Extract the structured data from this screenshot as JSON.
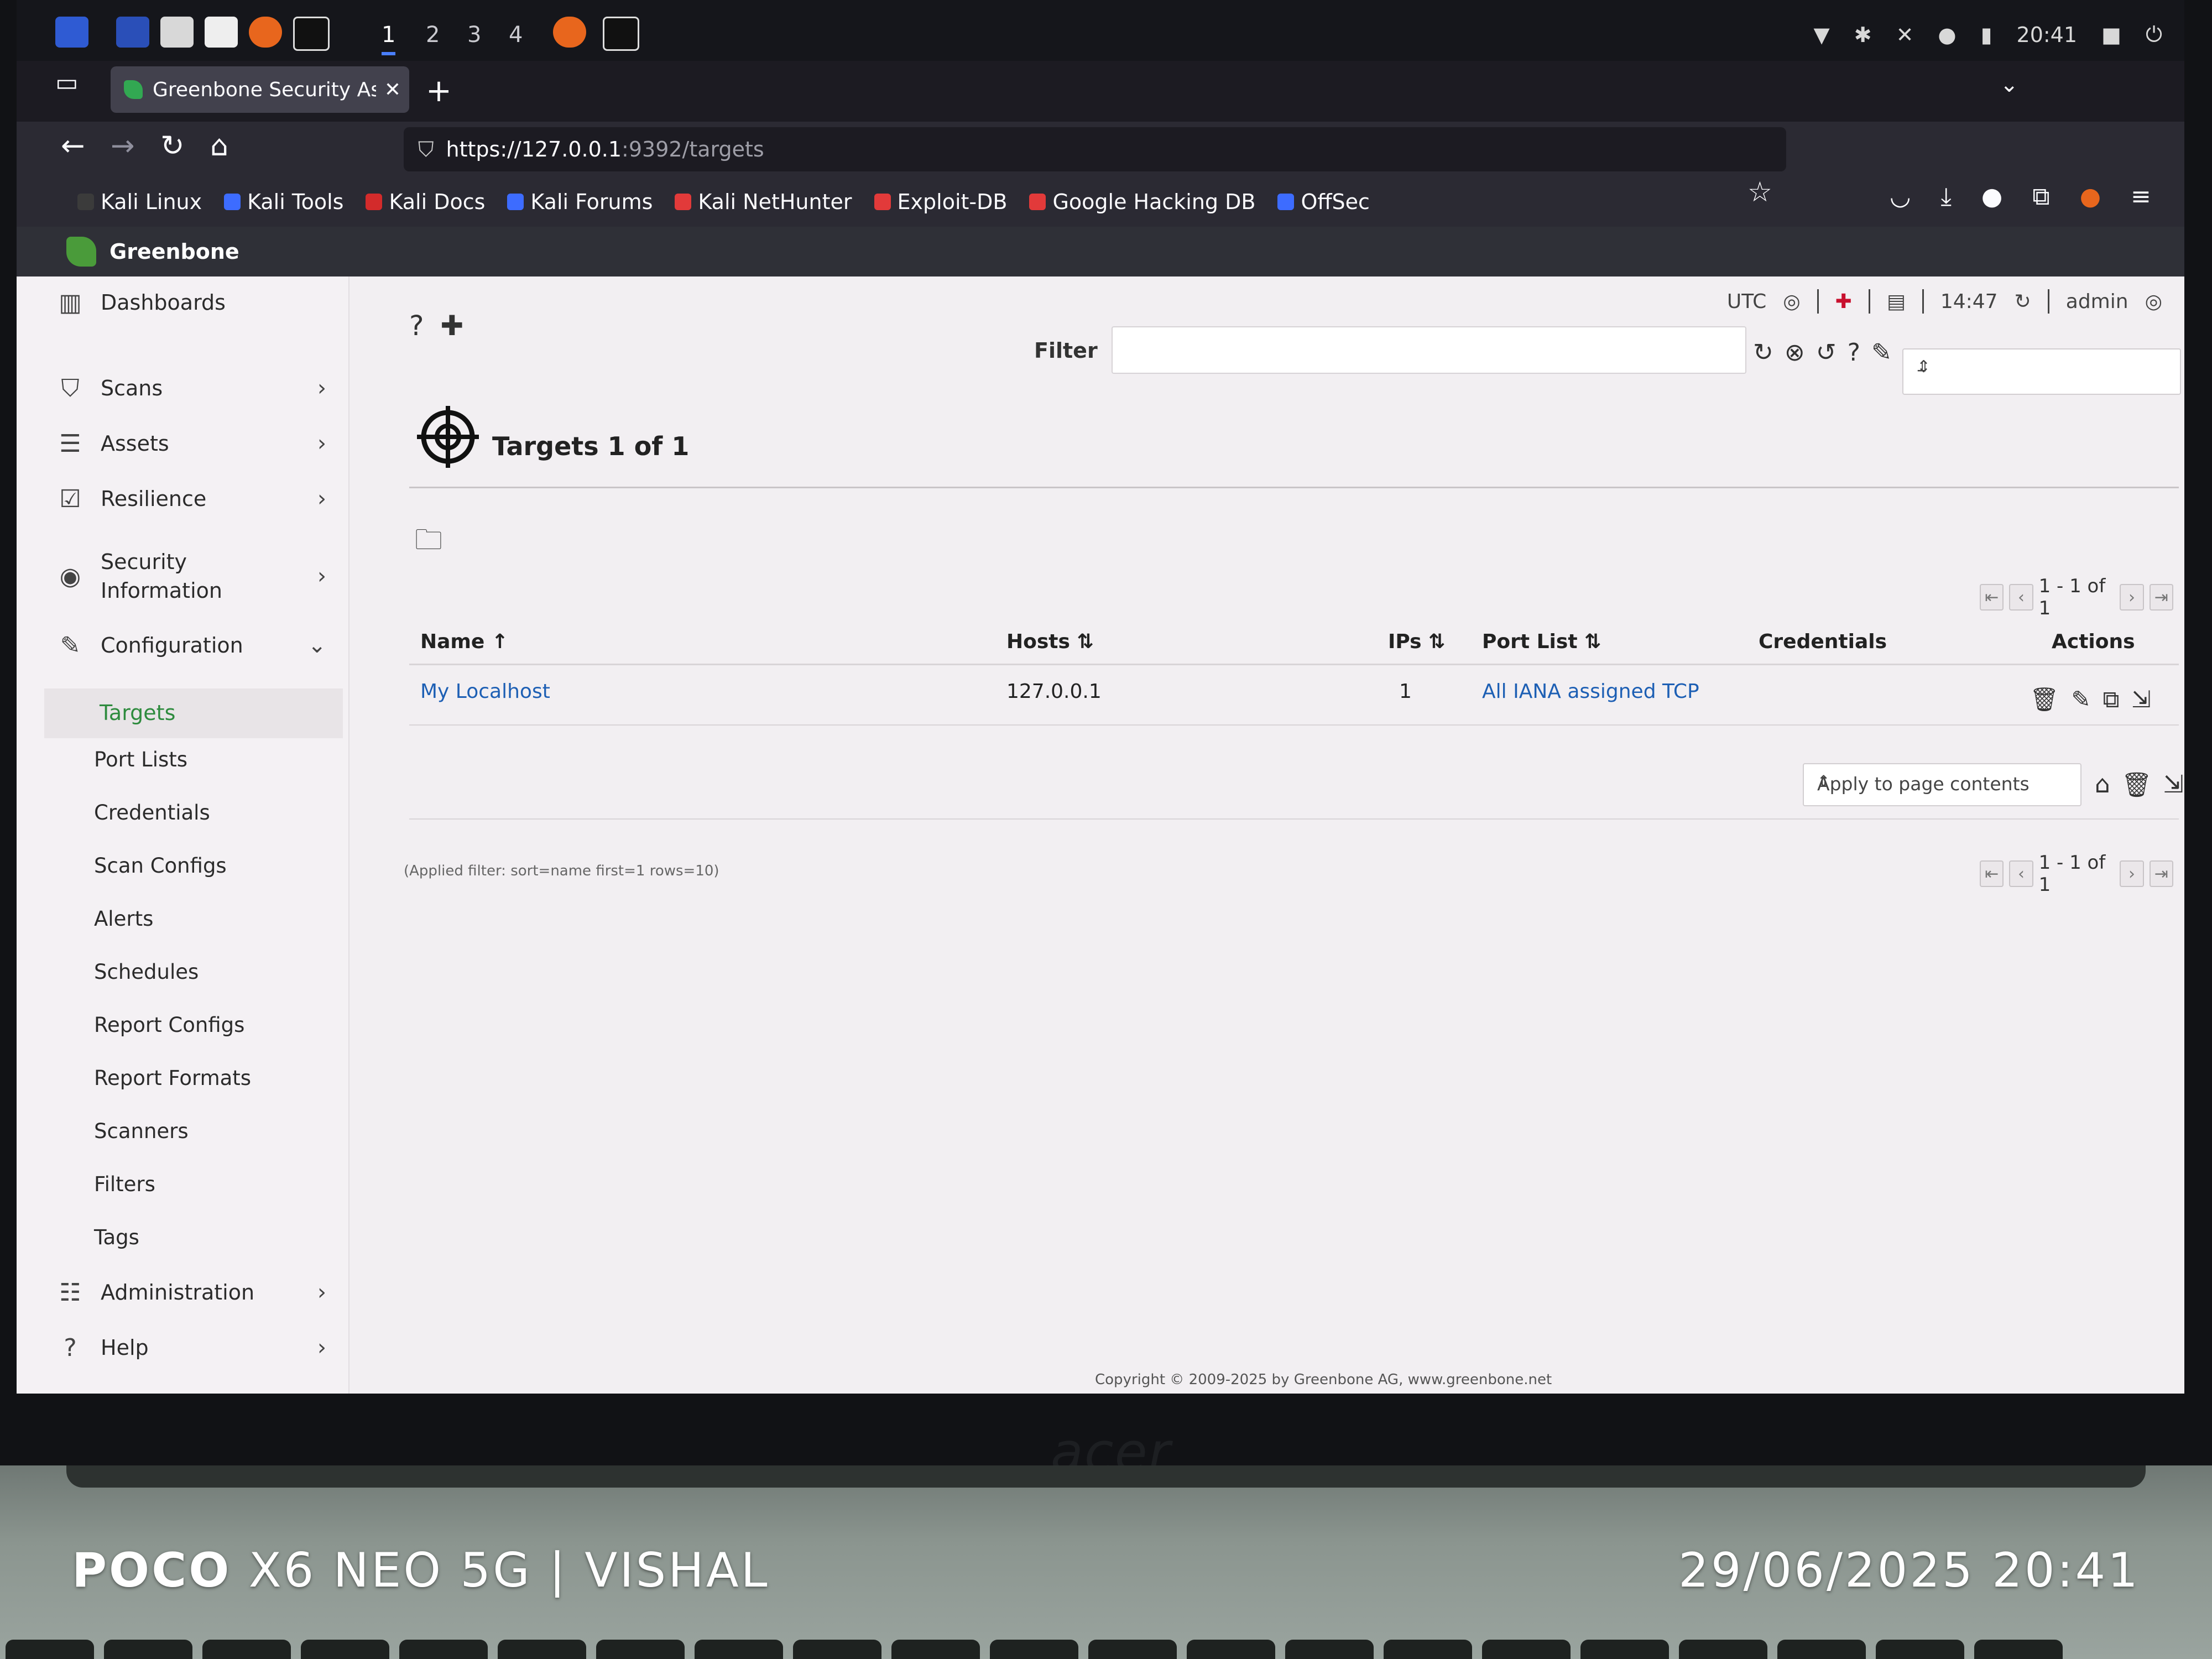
{
  "taskbar": {
    "workspaces": [
      "1",
      "2",
      "3",
      "4"
    ],
    "clock": "20:41"
  },
  "browser": {
    "tab_title": "Greenbone Security Assis",
    "url_host": "https://127.0.0.1",
    "url_path": ":9392/targets",
    "bookmarks": [
      {
        "label": "Kali Linux",
        "color": "#3b3b3b"
      },
      {
        "label": "Kali Tools",
        "color": "#3d6cff"
      },
      {
        "label": "Kali Docs",
        "color": "#d32b2b"
      },
      {
        "label": "Kali Forums",
        "color": "#3d6cff"
      },
      {
        "label": "Kali NetHunter",
        "color": "#e23a3a"
      },
      {
        "label": "Exploit-DB",
        "color": "#e23a3a"
      },
      {
        "label": "Google Hacking DB",
        "color": "#e23a3a"
      },
      {
        "label": "OffSec",
        "color": "#3d6cff"
      }
    ]
  },
  "app": {
    "name": "Greenbone",
    "timezone": "UTC",
    "time": "14:47",
    "user": "admin"
  },
  "sidebar": {
    "items": [
      {
        "label": "Dashboards",
        "icon": "chart-icon",
        "has_chevron": false
      },
      {
        "label": "Scans",
        "icon": "shield-icon",
        "has_chevron": true
      },
      {
        "label": "Assets",
        "icon": "server-icon",
        "has_chevron": true
      },
      {
        "label": "Resilience",
        "icon": "checklist-icon",
        "has_chevron": true
      },
      {
        "label": "Security Information",
        "icon": "eye-icon",
        "has_chevron": true
      },
      {
        "label": "Configuration",
        "icon": "wrench-icon",
        "has_chevron": true
      },
      {
        "label": "Administration",
        "icon": "sliders-icon",
        "has_chevron": true
      },
      {
        "label": "Help",
        "icon": "help-icon",
        "has_chevron": true
      }
    ],
    "config_sub": [
      "Targets",
      "Port Lists",
      "Credentials",
      "Scan Configs",
      "Alerts",
      "Schedules",
      "Report Configs",
      "Report Formats",
      "Scanners",
      "Filters",
      "Tags"
    ],
    "active": "Targets"
  },
  "main": {
    "filter_label": "Filter",
    "filter_value": "",
    "filter_select": "–",
    "title": "Targets 1 of 1",
    "pagination": "1 - 1 of 1",
    "table": {
      "headers": [
        "Name",
        "Hosts",
        "IPs",
        "Port List",
        "Credentials",
        "Actions"
      ],
      "sort_markers": [
        "↑",
        "⇅",
        "⇅",
        "⇅"
      ],
      "rows": [
        {
          "name": "My Localhost",
          "hosts": "127.0.0.1",
          "ips": "1",
          "port_list": "All IANA assigned TCP",
          "credentials": ""
        }
      ]
    },
    "bulk_action": "Apply to page contents",
    "applied_filter": "(Applied filter: sort=name first=1 rows=10)",
    "copyright": "Copyright © 2009-2025 by Greenbone AG, www.greenbone.net"
  },
  "watermark": {
    "brand": "POCO",
    "model": "X6 NEO 5G | VISHAL",
    "datetime": "29/06/2025 20:41"
  },
  "laptop_brand": "acer"
}
